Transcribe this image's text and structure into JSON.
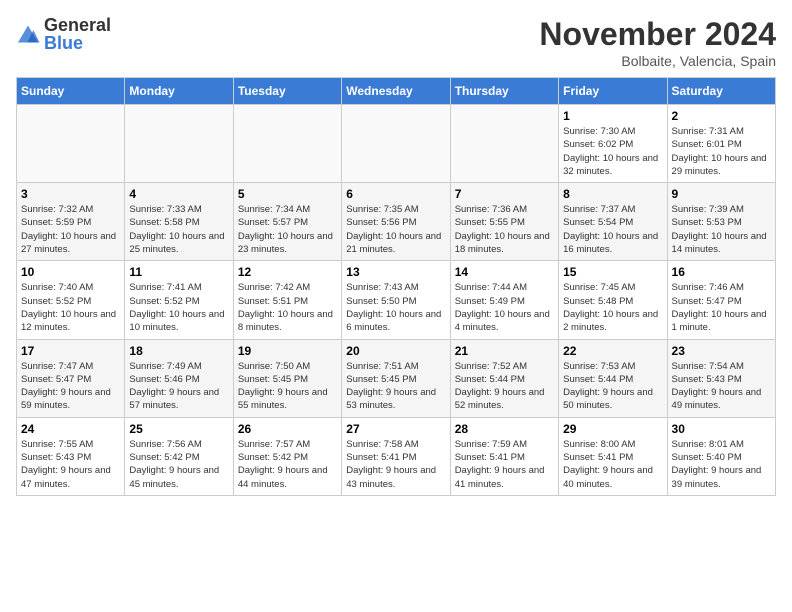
{
  "logo": {
    "text_general": "General",
    "text_blue": "Blue"
  },
  "header": {
    "month": "November 2024",
    "location": "Bolbaite, Valencia, Spain"
  },
  "weekdays": [
    "Sunday",
    "Monday",
    "Tuesday",
    "Wednesday",
    "Thursday",
    "Friday",
    "Saturday"
  ],
  "weeks": [
    [
      {
        "day": "",
        "info": ""
      },
      {
        "day": "",
        "info": ""
      },
      {
        "day": "",
        "info": ""
      },
      {
        "day": "",
        "info": ""
      },
      {
        "day": "",
        "info": ""
      },
      {
        "day": "1",
        "info": "Sunrise: 7:30 AM\nSunset: 6:02 PM\nDaylight: 10 hours and 32 minutes."
      },
      {
        "day": "2",
        "info": "Sunrise: 7:31 AM\nSunset: 6:01 PM\nDaylight: 10 hours and 29 minutes."
      }
    ],
    [
      {
        "day": "3",
        "info": "Sunrise: 7:32 AM\nSunset: 5:59 PM\nDaylight: 10 hours and 27 minutes."
      },
      {
        "day": "4",
        "info": "Sunrise: 7:33 AM\nSunset: 5:58 PM\nDaylight: 10 hours and 25 minutes."
      },
      {
        "day": "5",
        "info": "Sunrise: 7:34 AM\nSunset: 5:57 PM\nDaylight: 10 hours and 23 minutes."
      },
      {
        "day": "6",
        "info": "Sunrise: 7:35 AM\nSunset: 5:56 PM\nDaylight: 10 hours and 21 minutes."
      },
      {
        "day": "7",
        "info": "Sunrise: 7:36 AM\nSunset: 5:55 PM\nDaylight: 10 hours and 18 minutes."
      },
      {
        "day": "8",
        "info": "Sunrise: 7:37 AM\nSunset: 5:54 PM\nDaylight: 10 hours and 16 minutes."
      },
      {
        "day": "9",
        "info": "Sunrise: 7:39 AM\nSunset: 5:53 PM\nDaylight: 10 hours and 14 minutes."
      }
    ],
    [
      {
        "day": "10",
        "info": "Sunrise: 7:40 AM\nSunset: 5:52 PM\nDaylight: 10 hours and 12 minutes."
      },
      {
        "day": "11",
        "info": "Sunrise: 7:41 AM\nSunset: 5:52 PM\nDaylight: 10 hours and 10 minutes."
      },
      {
        "day": "12",
        "info": "Sunrise: 7:42 AM\nSunset: 5:51 PM\nDaylight: 10 hours and 8 minutes."
      },
      {
        "day": "13",
        "info": "Sunrise: 7:43 AM\nSunset: 5:50 PM\nDaylight: 10 hours and 6 minutes."
      },
      {
        "day": "14",
        "info": "Sunrise: 7:44 AM\nSunset: 5:49 PM\nDaylight: 10 hours and 4 minutes."
      },
      {
        "day": "15",
        "info": "Sunrise: 7:45 AM\nSunset: 5:48 PM\nDaylight: 10 hours and 2 minutes."
      },
      {
        "day": "16",
        "info": "Sunrise: 7:46 AM\nSunset: 5:47 PM\nDaylight: 10 hours and 1 minute."
      }
    ],
    [
      {
        "day": "17",
        "info": "Sunrise: 7:47 AM\nSunset: 5:47 PM\nDaylight: 9 hours and 59 minutes."
      },
      {
        "day": "18",
        "info": "Sunrise: 7:49 AM\nSunset: 5:46 PM\nDaylight: 9 hours and 57 minutes."
      },
      {
        "day": "19",
        "info": "Sunrise: 7:50 AM\nSunset: 5:45 PM\nDaylight: 9 hours and 55 minutes."
      },
      {
        "day": "20",
        "info": "Sunrise: 7:51 AM\nSunset: 5:45 PM\nDaylight: 9 hours and 53 minutes."
      },
      {
        "day": "21",
        "info": "Sunrise: 7:52 AM\nSunset: 5:44 PM\nDaylight: 9 hours and 52 minutes."
      },
      {
        "day": "22",
        "info": "Sunrise: 7:53 AM\nSunset: 5:44 PM\nDaylight: 9 hours and 50 minutes."
      },
      {
        "day": "23",
        "info": "Sunrise: 7:54 AM\nSunset: 5:43 PM\nDaylight: 9 hours and 49 minutes."
      }
    ],
    [
      {
        "day": "24",
        "info": "Sunrise: 7:55 AM\nSunset: 5:43 PM\nDaylight: 9 hours and 47 minutes."
      },
      {
        "day": "25",
        "info": "Sunrise: 7:56 AM\nSunset: 5:42 PM\nDaylight: 9 hours and 45 minutes."
      },
      {
        "day": "26",
        "info": "Sunrise: 7:57 AM\nSunset: 5:42 PM\nDaylight: 9 hours and 44 minutes."
      },
      {
        "day": "27",
        "info": "Sunrise: 7:58 AM\nSunset: 5:41 PM\nDaylight: 9 hours and 43 minutes."
      },
      {
        "day": "28",
        "info": "Sunrise: 7:59 AM\nSunset: 5:41 PM\nDaylight: 9 hours and 41 minutes."
      },
      {
        "day": "29",
        "info": "Sunrise: 8:00 AM\nSunset: 5:41 PM\nDaylight: 9 hours and 40 minutes."
      },
      {
        "day": "30",
        "info": "Sunrise: 8:01 AM\nSunset: 5:40 PM\nDaylight: 9 hours and 39 minutes."
      }
    ]
  ]
}
